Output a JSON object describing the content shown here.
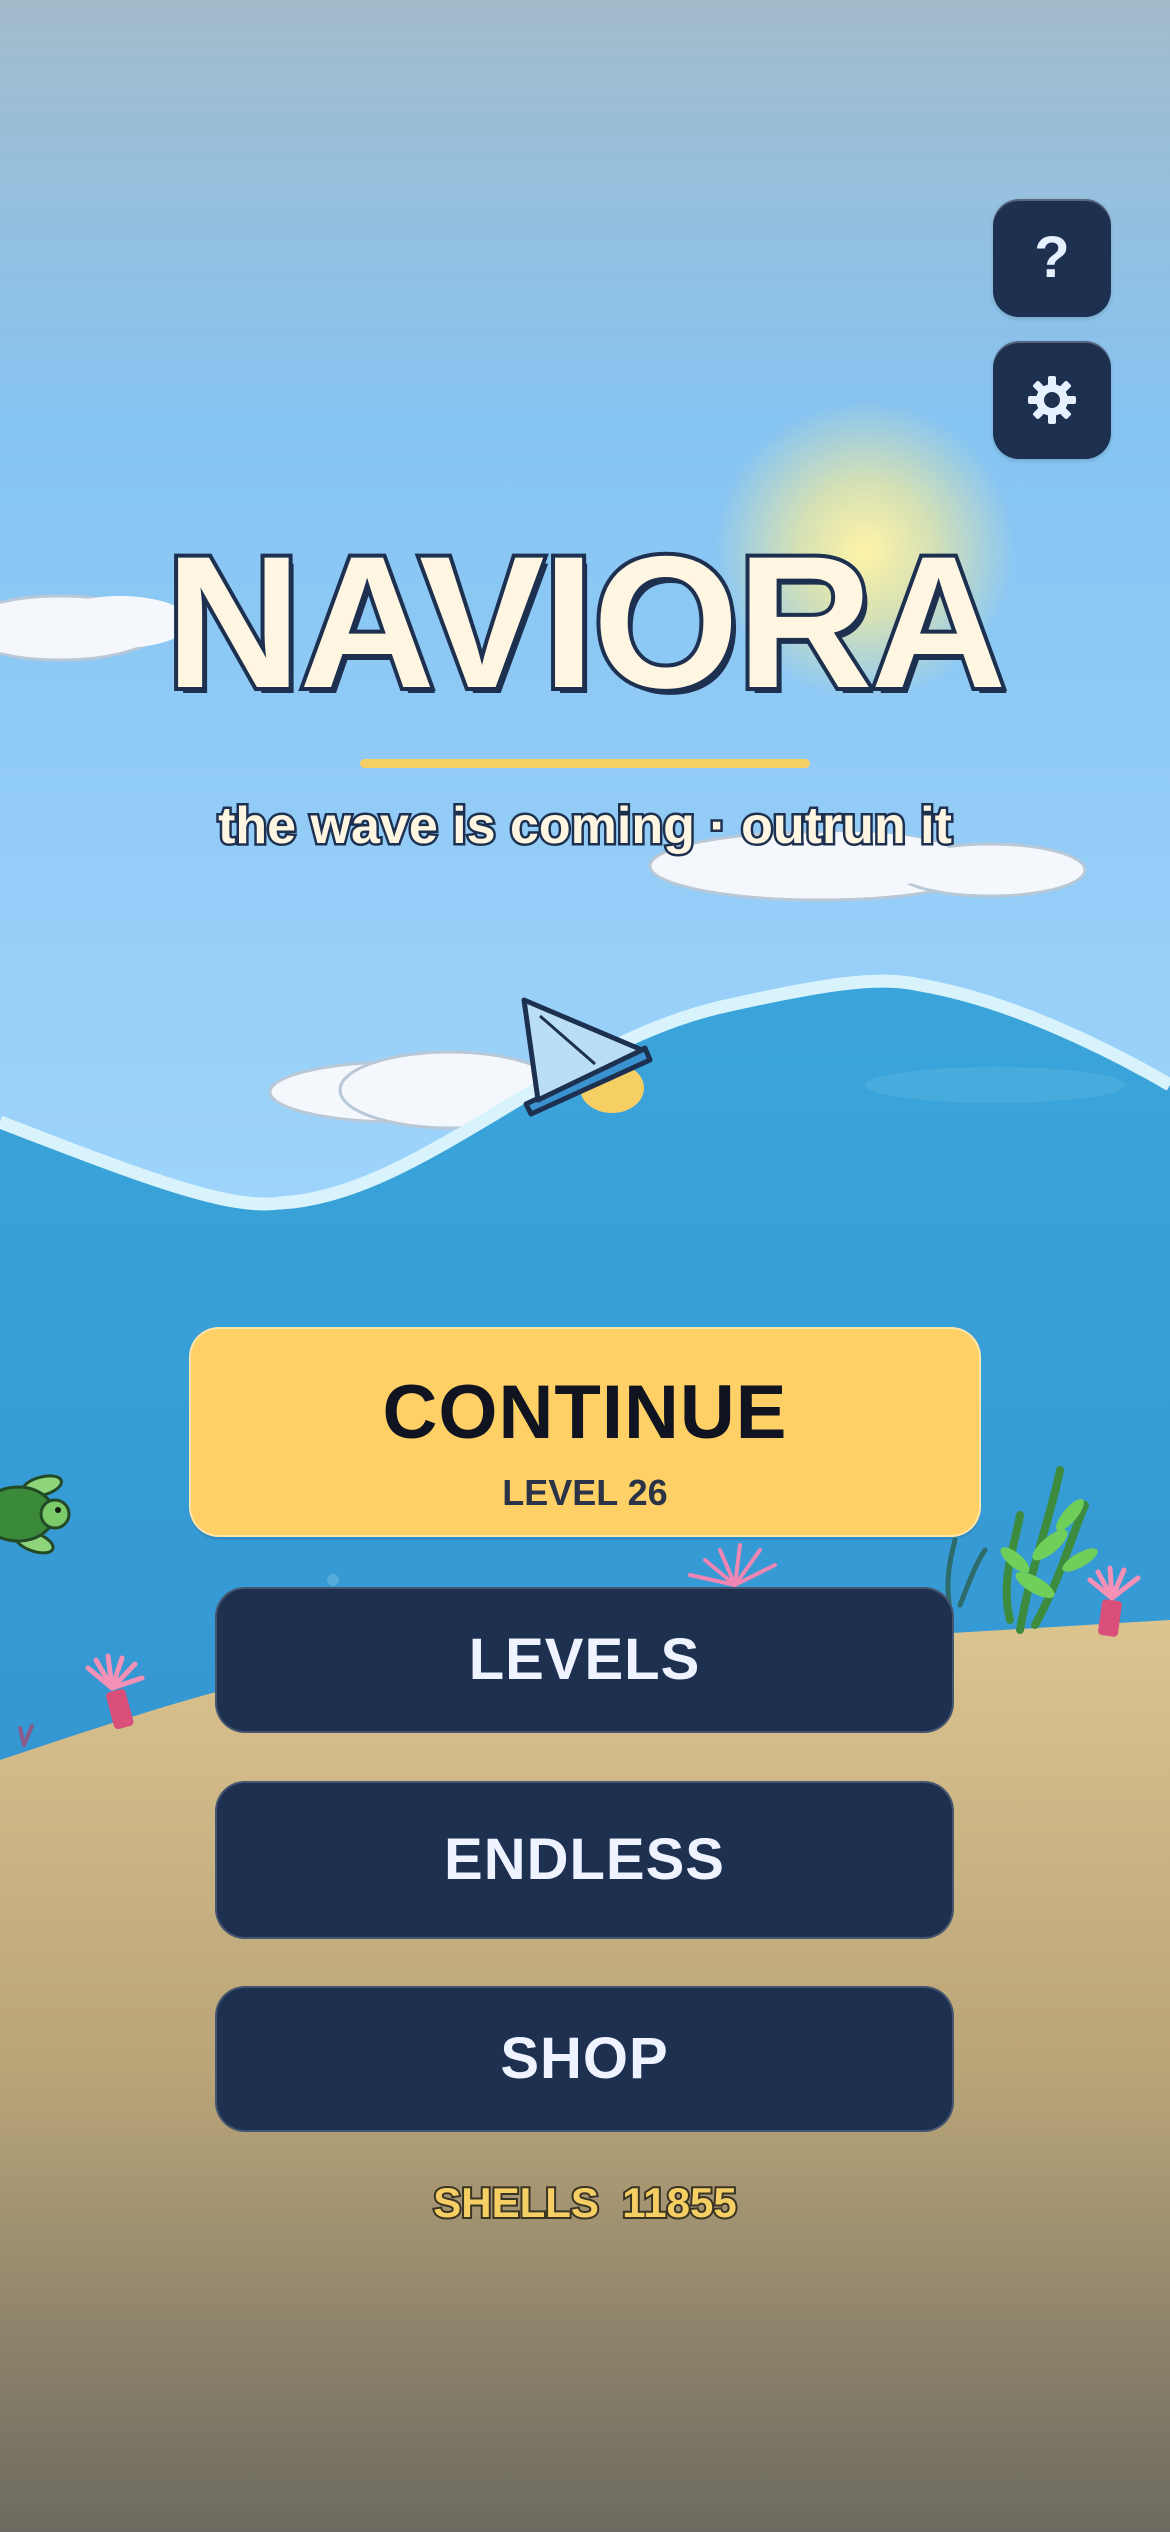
{
  "game": {
    "title": "NAVIORA",
    "tagline": "the wave is coming  ·  outrun it"
  },
  "top_buttons": {
    "help_label": "?",
    "help_icon": "question-icon",
    "settings_icon": "gear-icon"
  },
  "menu": {
    "continue_label": "CONTINUE",
    "continue_level": "LEVEL 26",
    "levels_label": "LEVELS",
    "endless_label": "ENDLESS",
    "shop_label": "SHOP"
  },
  "currency": {
    "label": "SHELLS",
    "amount": "11855",
    "display": "SHELLS  11855"
  },
  "colors": {
    "accent_yellow": "#ffd066",
    "button_navy": "#1d3050",
    "title_cream": "#fff6e1",
    "sea_blue": "#2f93cf",
    "sand": "#d7c08c"
  }
}
